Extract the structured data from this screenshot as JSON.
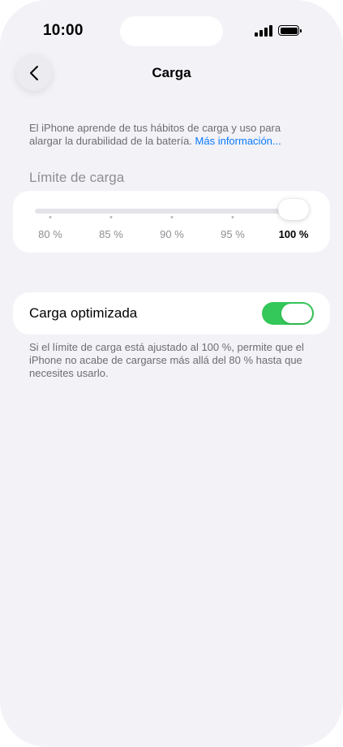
{
  "status_bar": {
    "time": "10:00",
    "icons": [
      "cellular-signal-icon",
      "battery-icon"
    ]
  },
  "nav": {
    "title": "Carga",
    "back_icon": "chevron-left-icon"
  },
  "description": {
    "text": "El iPhone aprende de tus hábitos de carga y uso para alargar la durabilidad de la batería. ",
    "link": "Más información..."
  },
  "charge_limit": {
    "header": "Límite de carga",
    "options": [
      "80 %",
      "85 %",
      "90 %",
      "95 %",
      "100 %"
    ],
    "selected": "100 %",
    "selected_index": 4
  },
  "optimized_charging": {
    "label": "Carga optimizada",
    "enabled": true,
    "accent_color": "#34c759",
    "note": "Si el límite de carga está ajustado al 100 %, permite que el iPhone no acabe de cargarse más allá del 80 % hasta que necesites usarlo."
  },
  "colors": {
    "background": "#f2f2f7",
    "link": "#0a7aff",
    "toggle_on": "#34c759"
  }
}
